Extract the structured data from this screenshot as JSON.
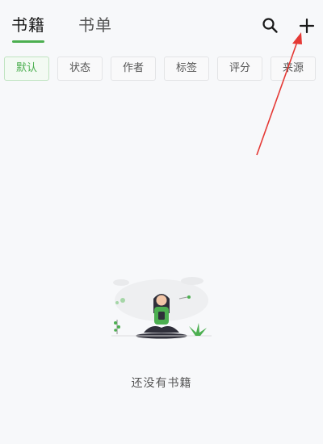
{
  "header": {
    "tabs": [
      {
        "label": "书籍",
        "active": true
      },
      {
        "label": "书单",
        "active": false
      }
    ],
    "search_icon": "search-icon",
    "add_icon": "plus-icon"
  },
  "filters": {
    "chips": [
      "默认",
      "状态",
      "作者",
      "标签",
      "评分",
      "来源"
    ],
    "active_index": 0
  },
  "empty_state": {
    "message": "还没有书籍",
    "illustration": "person-reading-on-phone"
  },
  "annotation": {
    "type": "arrow",
    "points_to": "add-button"
  },
  "colors": {
    "accent": "#4caf50",
    "underline": "#4caf50",
    "annotation_arrow": "#e53935",
    "background": "#f7f8fa"
  }
}
